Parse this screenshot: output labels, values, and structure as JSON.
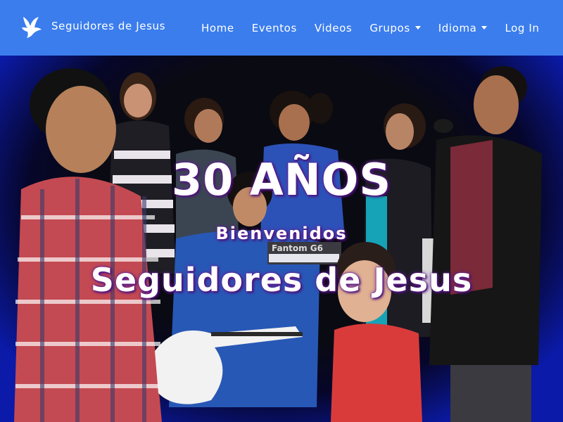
{
  "navbar": {
    "brand_icon": "dove-icon",
    "brand_text": "Seguidores de Jesus",
    "items": [
      {
        "label": "Home"
      },
      {
        "label": "Eventos"
      },
      {
        "label": "Videos"
      },
      {
        "label": "Grupos",
        "dropdown": true
      },
      {
        "label": "Idioma",
        "dropdown": true
      },
      {
        "label": "Log In"
      }
    ],
    "colors": {
      "background": "#3b7ded",
      "text": "#ffffff"
    }
  },
  "hero": {
    "headline": "30 AÑOS",
    "welcome": "Bienvenidos",
    "title": "Seguidores de Jesus",
    "keyboard_label": "Fantom G6",
    "colors": {
      "text": "#ffffff",
      "glow": "#6b1f9e",
      "edge": "#0b1aa8"
    }
  }
}
